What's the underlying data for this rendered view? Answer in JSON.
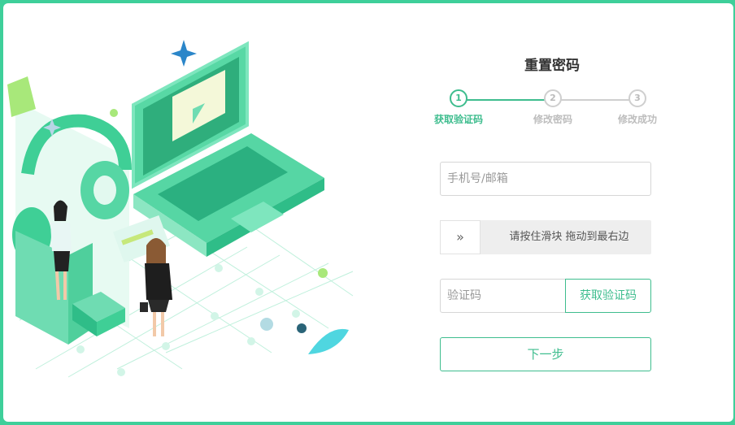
{
  "page": {
    "title": "重置密码"
  },
  "steps": [
    {
      "number": "1",
      "label": "获取验证码",
      "active": true
    },
    {
      "number": "2",
      "label": "修改密码",
      "active": false
    },
    {
      "number": "3",
      "label": "修改成功",
      "active": false
    }
  ],
  "form": {
    "account_placeholder": "手机号/邮箱",
    "slider_handle": "»",
    "slider_text": "请按住滑块  拖动到最右边",
    "code_placeholder": "验证码",
    "get_code_label": "获取验证码",
    "next_label": "下一步"
  },
  "colors": {
    "accent": "#3ebd8e",
    "background": "#3ecf9a",
    "inactive": "#cfcfcf"
  },
  "icons": {
    "slider_handle": "double-chevron-right-icon",
    "illustration": "laptop-video-illustration"
  }
}
